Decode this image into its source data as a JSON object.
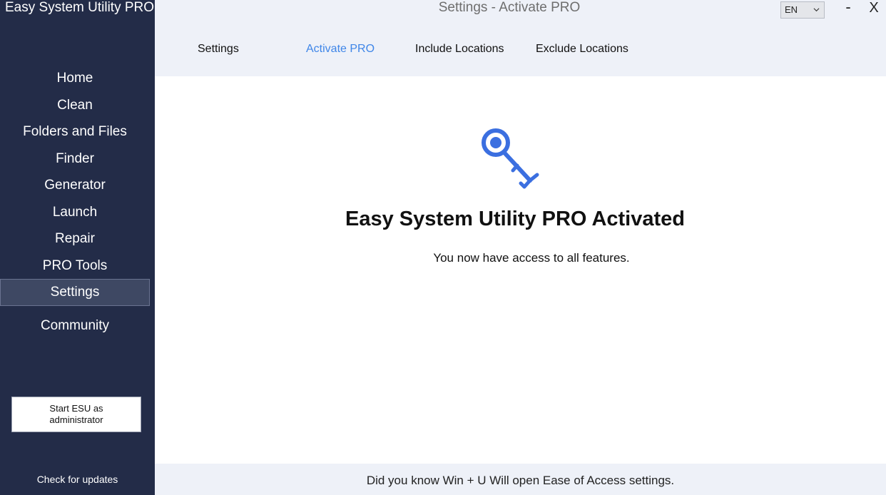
{
  "app": {
    "title": "Easy System Utility PRO"
  },
  "window": {
    "title": "Settings - Activate PRO",
    "minimize_label": "-",
    "close_label": "X",
    "language": "EN"
  },
  "sidebar": {
    "items": [
      {
        "label": "Home"
      },
      {
        "label": "Clean"
      },
      {
        "label": "Folders and Files"
      },
      {
        "label": "Finder"
      },
      {
        "label": "Generator"
      },
      {
        "label": "Launch"
      },
      {
        "label": "Repair"
      },
      {
        "label": "PRO Tools"
      },
      {
        "label": "Settings",
        "active": true
      },
      {
        "label": "Community"
      }
    ],
    "admin_button": "Start ESU as administrator",
    "check_updates": "Check for updates"
  },
  "tabs": [
    {
      "label": "Settings"
    },
    {
      "label": "Activate PRO",
      "active": true
    },
    {
      "label": "Include Locations"
    },
    {
      "label": "Exclude Locations"
    }
  ],
  "main": {
    "icon": "key-icon",
    "heading": "Easy System Utility PRO Activated",
    "subtext": "You now have access to all features."
  },
  "footer": {
    "tip": "Did you know Win + U Will open Ease of Access settings."
  },
  "colors": {
    "sidebar_bg": "#232c48",
    "accent": "#3f86e8",
    "icon_blue": "#3b6fe0",
    "panel_bg": "#eef1f8"
  }
}
